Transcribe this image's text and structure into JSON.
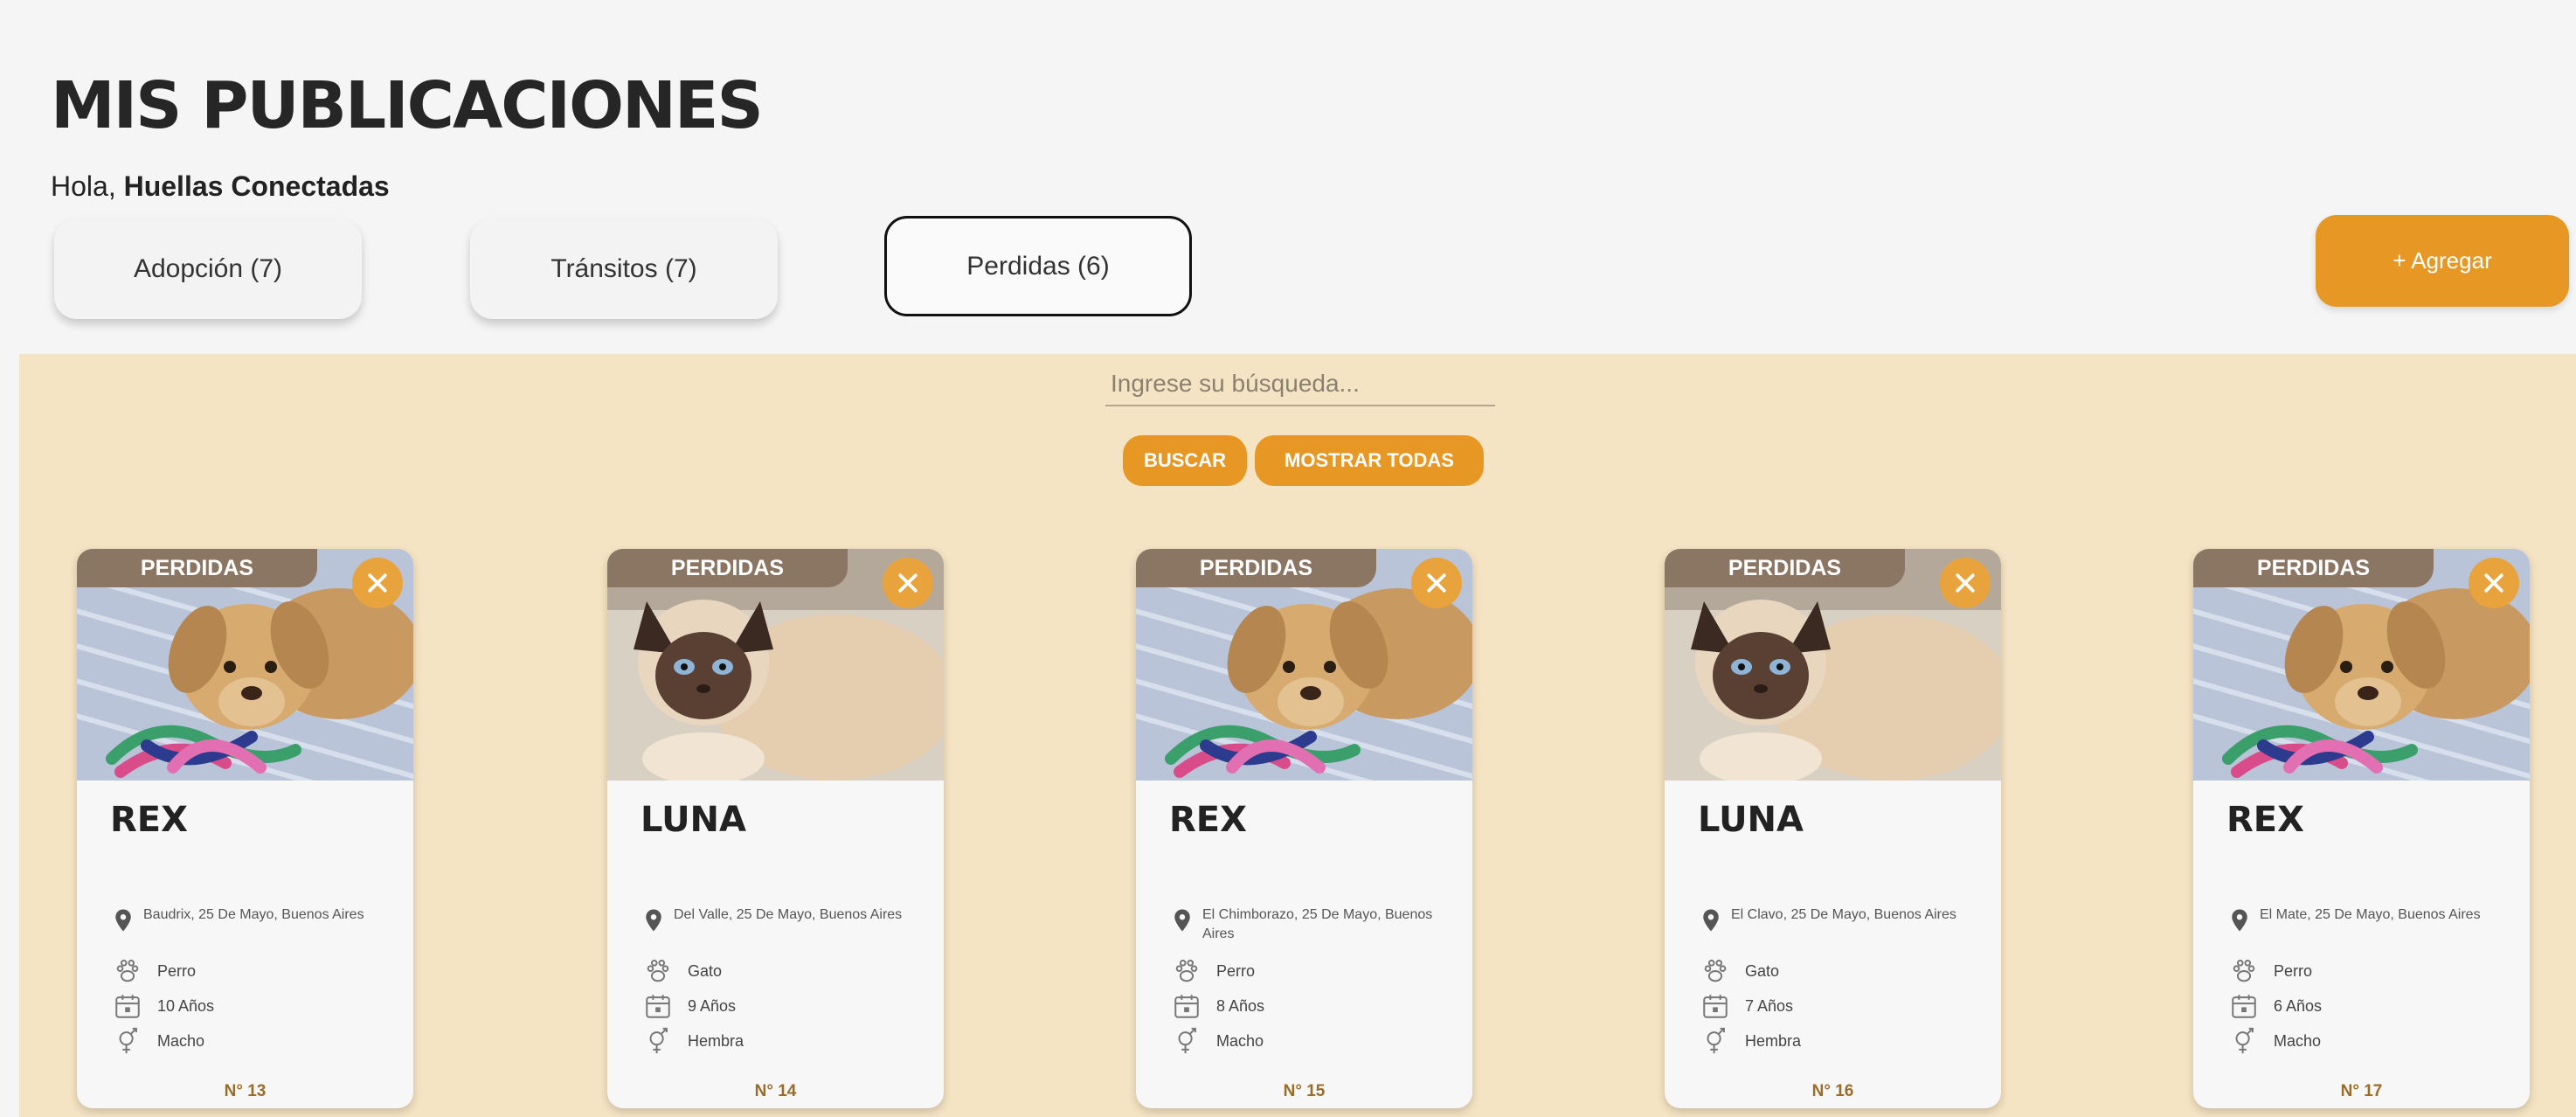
{
  "header": {
    "title": "MIS PUBLICACIONES",
    "greeting_prefix": "Hola, ",
    "greeting_name": "Huellas Conectadas"
  },
  "tabs": [
    {
      "label": "Adopción (7)",
      "active": false
    },
    {
      "label": "Tránsitos (7)",
      "active": false
    },
    {
      "label": "Perdidas (6)",
      "active": true
    }
  ],
  "add_button": "+ Agregar",
  "search": {
    "placeholder": "Ingrese su búsqueda...",
    "search_label": "BUSCAR",
    "show_all_label": "MOSTRAR TODAS"
  },
  "colors": {
    "accent": "#e79824",
    "content_bg": "#f5e4c3",
    "badge_bg": "#8b7563"
  },
  "cards": [
    {
      "badge": "PERDIDAS",
      "name": "REX",
      "location": "Baudrix, 25 De Mayo, Buenos Aires",
      "species": "Perro",
      "age": "10 Años",
      "sex": "Macho",
      "number": "N° 13",
      "photo": "puppy"
    },
    {
      "badge": "PERDIDAS",
      "name": "LUNA",
      "location": "Del Valle, 25 De Mayo, Buenos Aires",
      "species": "Gato",
      "age": "9 Años",
      "sex": "Hembra",
      "number": "N° 14",
      "photo": "cat"
    },
    {
      "badge": "PERDIDAS",
      "name": "REX",
      "location": "El Chimborazo, 25 De Mayo, Buenos Aires",
      "species": "Perro",
      "age": "8 Años",
      "sex": "Macho",
      "number": "N° 15",
      "photo": "puppy"
    },
    {
      "badge": "PERDIDAS",
      "name": "LUNA",
      "location": "El Clavo, 25 De Mayo, Buenos Aires",
      "species": "Gato",
      "age": "7 Años",
      "sex": "Hembra",
      "number": "N° 16",
      "photo": "cat"
    },
    {
      "badge": "PERDIDAS",
      "name": "REX",
      "location": "El Mate, 25 De Mayo, Buenos Aires",
      "species": "Perro",
      "age": "6 Años",
      "sex": "Macho",
      "number": "N° 17",
      "photo": "puppy"
    }
  ],
  "icons": {
    "close": "close-icon",
    "location": "location-pin-icon",
    "species": "paw-icon",
    "age": "calendar-icon",
    "sex": "gender-icon"
  }
}
